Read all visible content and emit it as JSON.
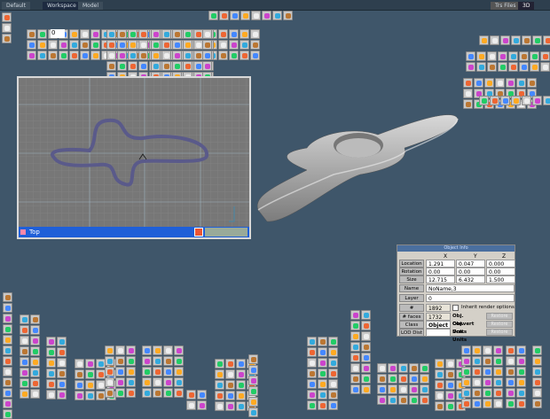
{
  "tabs": [
    "Default",
    "Workspace",
    "Model"
  ],
  "right_controls": {
    "files": "Trs Files",
    "mode": "3D"
  },
  "animation": {
    "frame": "0"
  },
  "viewport": {
    "title": "Top"
  },
  "object_info": {
    "title": "Object Info",
    "columns": [
      "X",
      "Y",
      "Z"
    ],
    "rows": [
      {
        "label": "Location",
        "values": [
          "1.291",
          "0.047",
          "0.000"
        ]
      },
      {
        "label": "Rotation",
        "values": [
          "0.00",
          "0.00",
          "0.00"
        ]
      },
      {
        "label": "Size",
        "values": [
          "12.715",
          "6.432",
          "1.500"
        ]
      }
    ],
    "name_label": "Name",
    "name_value": "NoName,3",
    "layer_label": "Layer",
    "layer_value": "0",
    "vertices_label": "# vertices",
    "vertices": "1892",
    "faces_label": "# faces",
    "faces": "1732",
    "class_label": "Class",
    "class_value": "Object",
    "lod_label": "LOD Dist",
    "inherit_label": "Inherit render options",
    "obj_convert": "Obj. Convert",
    "obj_units": "Obj. Units",
    "scn_units": "Scn. Units",
    "restore": "Restore"
  },
  "colors": {
    "background": "#3f566a",
    "viewport_bar": "#1f5fd8",
    "panel": "#d4d0c8"
  }
}
